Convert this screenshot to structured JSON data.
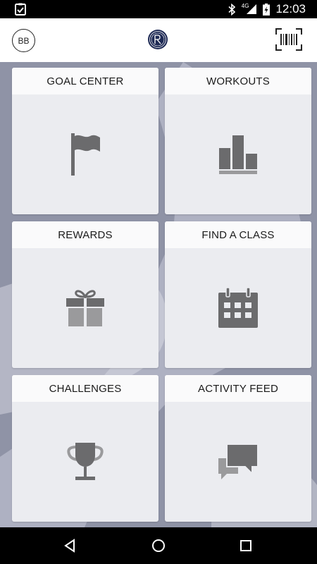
{
  "status_bar": {
    "time": "12:03",
    "network": "4G",
    "icons": [
      "clipboard-check-icon",
      "bluetooth-icon",
      "signal-icon",
      "battery-icon"
    ]
  },
  "app_bar": {
    "avatar_initials": "BB",
    "logo_icon": "club-logo-icon",
    "barcode_icon": "barcode-scan-icon"
  },
  "tiles": [
    {
      "label": "GOAL CENTER",
      "icon": "flag-icon"
    },
    {
      "label": "WORKOUTS",
      "icon": "bar-chart-icon"
    },
    {
      "label": "REWARDS",
      "icon": "gift-icon"
    },
    {
      "label": "FIND A CLASS",
      "icon": "calendar-icon"
    },
    {
      "label": "CHALLENGES",
      "icon": "trophy-icon"
    },
    {
      "label": "ACTIVITY FEED",
      "icon": "chat-bubbles-icon"
    }
  ],
  "nav_bar": {
    "buttons": [
      "back-icon",
      "home-icon",
      "recents-icon"
    ]
  },
  "colors": {
    "tile_icon": "#6b6b6d",
    "tile_header_bg": "#fafafb",
    "tile_body_bg": "#ebecf0",
    "content_bg": "#8f93a6",
    "logo_navy": "#1e2a55"
  }
}
